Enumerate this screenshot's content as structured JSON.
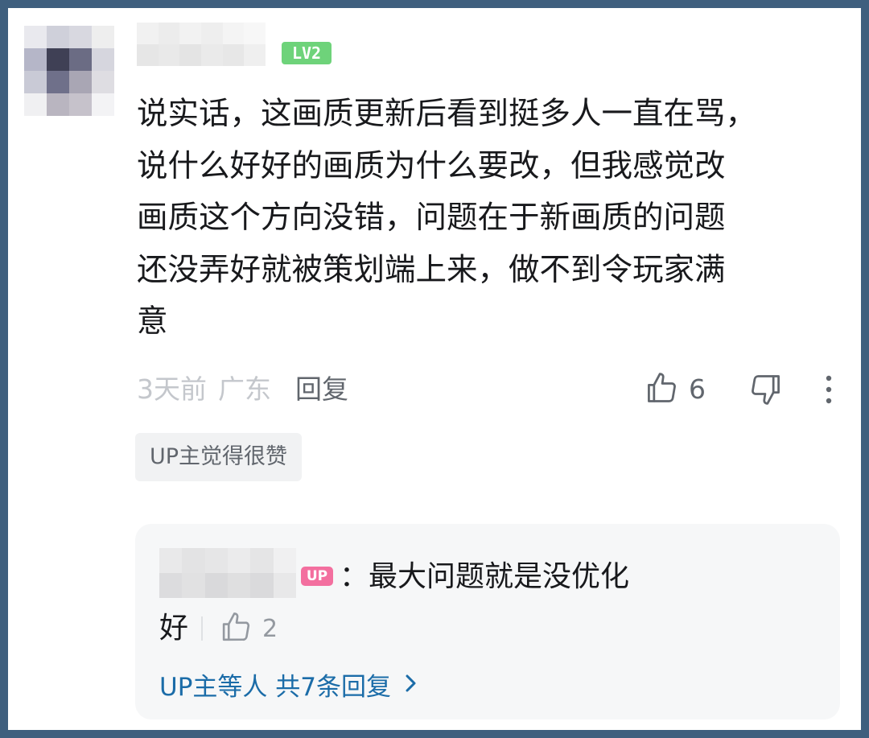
{
  "comment": {
    "level_badge": "LV2",
    "text": "说实话，这画质更新后看到挺多人一直在骂，\n说什么好好的画质为什么要改，但我感觉改\n画质这个方向没错，问题在于新画质的问题\n还没弄好就被策划端上来，做不到令玩家满\n意",
    "time": "3天前",
    "location": "广东",
    "reply_label": "回复",
    "like_count": "6",
    "up_liked_label": "UP主觉得很赞"
  },
  "sub_reply": {
    "up_tag": "UP",
    "text": "：最大问题就是没优化",
    "trailing_text": "好",
    "like_count": "2",
    "view_all_label": "UP主等人 共7条回复"
  },
  "icons": {
    "like": "thumbs-up-icon",
    "dislike": "thumbs-down-icon",
    "more": "more-vertical-icon",
    "chevron": "chevron-right-icon"
  },
  "colors": {
    "background_frame": "#3f5f7e",
    "level_badge": "#6ed37a",
    "up_tag": "#f36f9f",
    "link": "#1b6ca8"
  }
}
